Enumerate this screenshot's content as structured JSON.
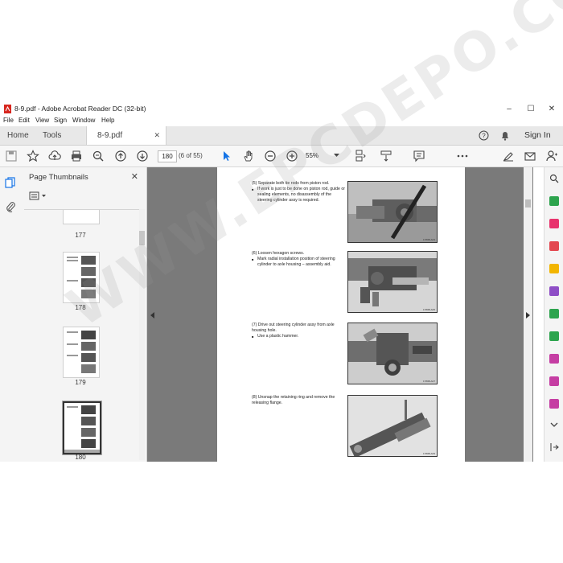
{
  "window": {
    "title": "8-9.pdf - Adobe Acrobat Reader DC (32-bit)",
    "minimize": "–",
    "maximize": "☐",
    "close": "✕"
  },
  "menu": [
    "File",
    "Edit",
    "View",
    "Sign",
    "Window",
    "Help"
  ],
  "tabs": {
    "home": "Home",
    "tools": "Tools",
    "document": "8-9.pdf",
    "doc_close": "✕",
    "sign_in": "Sign In"
  },
  "toolbar": {
    "page_number": "180",
    "page_count": "(6 of 55)",
    "zoom": "55%"
  },
  "panel": {
    "title": "Page Thumbnails",
    "close": "✕",
    "thumbnails": [
      {
        "label": "177"
      },
      {
        "label": "178"
      },
      {
        "label": "179"
      },
      {
        "label": "180"
      }
    ]
  },
  "document": {
    "steps": [
      {
        "heading": "(5) Separate both tie rods from piston rod.",
        "bullet": "If work is just to be done on piston rod, guide or sealing elements, no disassembly of the steering cylinder assy is required.",
        "caption": "1780B-A03"
      },
      {
        "heading": "(6) Loosen hexagon screws.",
        "bullet": "Mark radial installation position of steering cylinder to axle housing – assembly aid.",
        "caption": "1780B-A05"
      },
      {
        "heading": "(7) Drive out steering cylinder assy from axle housing hole.",
        "bullet": "Use a plastic hammer.",
        "caption": "1780B-A07"
      },
      {
        "heading": "(8) Unsnap the retaining ring and remove the releasing flange.",
        "bullet": "",
        "caption": "1780B-A09"
      }
    ],
    "watermark": "WWW.EPCDEPO.COM"
  },
  "colors": {
    "accent": "#1473e6",
    "acrobat_red": "#d7261e",
    "doc_bg": "#7a7a7a"
  }
}
